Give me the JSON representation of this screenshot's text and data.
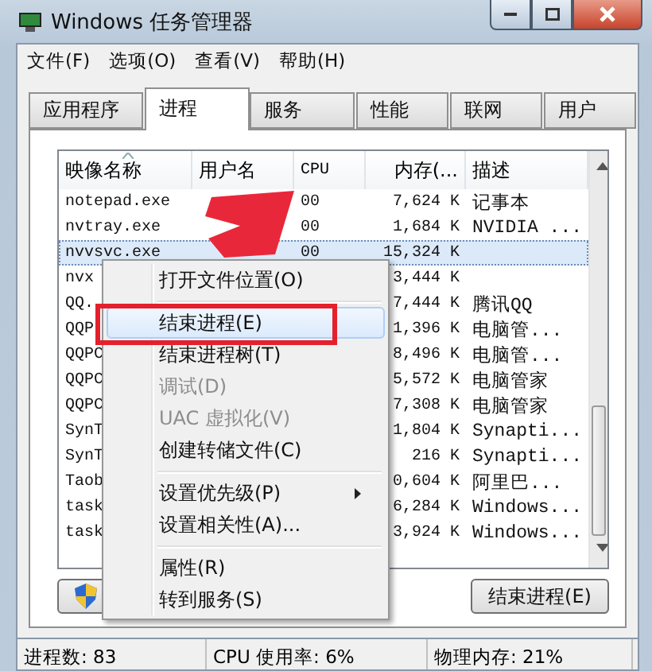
{
  "window": {
    "title": "Windows 任务管理器"
  },
  "menu_bar": [
    "文件(F)",
    "选项(O)",
    "查看(V)",
    "帮助(H)"
  ],
  "tabs": [
    {
      "label": "应用程序",
      "selected": false
    },
    {
      "label": "进程",
      "selected": true
    },
    {
      "label": "服务",
      "selected": false
    },
    {
      "label": "性能",
      "selected": false
    },
    {
      "label": "联网",
      "selected": false
    },
    {
      "label": "用户",
      "selected": false
    }
  ],
  "table": {
    "columns": [
      {
        "label": "映像名称",
        "sorted": true
      },
      {
        "label": "用户名",
        "sorted": false
      },
      {
        "label": "CPU",
        "sorted": false
      },
      {
        "label": "内存(...",
        "sorted": false
      },
      {
        "label": "描述",
        "sorted": false
      }
    ],
    "redaction": {
      "kind": "scribble"
    },
    "rows": [
      {
        "name": "notepad.exe",
        "cpu": "00",
        "memory": "7,624 K",
        "description": "记事本",
        "selected": false
      },
      {
        "name": "nvtray.exe",
        "cpu": "00",
        "memory": "1,684 K",
        "description": "NVIDIA ...",
        "selected": false
      },
      {
        "name": "nvvsvc.exe",
        "cpu": "00",
        "memory": "15,324 K",
        "selected": true
      },
      {
        "name": "nvx",
        "memory": "3,444 K",
        "selected": false
      },
      {
        "name": "QQ.",
        "memory": "7,444 K",
        "description": "腾讯QQ",
        "selected": false
      },
      {
        "name": "QQP",
        "memory": "1,396 K",
        "description": "电脑管...",
        "selected": false
      },
      {
        "name": "QQPC",
        "memory": "8,496 K",
        "description": "电脑管...",
        "selected": false
      },
      {
        "name": "QQPC",
        "memory": "5,572 K",
        "description": "电脑管家",
        "selected": false
      },
      {
        "name": "QQPC",
        "memory": "7,308 K",
        "description": "电脑管家",
        "selected": false
      },
      {
        "name": "SynT",
        "memory": "1,804 K",
        "description": "Synapti...",
        "selected": false
      },
      {
        "name": "SynT",
        "memory": "216 K",
        "description": "Synapti...",
        "selected": false
      },
      {
        "name": "Taob",
        "memory": "0,604 K",
        "description": "阿里巴...",
        "selected": false
      },
      {
        "name": "task",
        "memory": "6,284 K",
        "description": "Windows...",
        "selected": false
      },
      {
        "name": "task",
        "memory": "3,924 K",
        "description": "Windows...",
        "selected": false
      }
    ]
  },
  "buttons": [
    {
      "kind": "shield"
    },
    {
      "kind": "text",
      "label": "结束进程(E)"
    }
  ],
  "context_menu": {
    "items": [
      {
        "kind": "item",
        "label": "打开文件位置(O)",
        "disabled": false,
        "highlighted": false,
        "submenu": false,
        "boxed": false
      },
      {
        "kind": "separator"
      },
      {
        "kind": "item",
        "label": "结束进程(E)",
        "disabled": false,
        "highlighted": true,
        "submenu": false,
        "boxed": true
      },
      {
        "kind": "item",
        "label": "结束进程树(T)",
        "disabled": false,
        "highlighted": false,
        "submenu": false,
        "boxed": false
      },
      {
        "kind": "item",
        "label": "调试(D)",
        "disabled": true,
        "highlighted": false,
        "submenu": false,
        "boxed": false
      },
      {
        "kind": "item",
        "label": "UAC 虚拟化(V)",
        "disabled": true,
        "highlighted": false,
        "submenu": false,
        "boxed": false
      },
      {
        "kind": "item",
        "label": "创建转储文件(C)",
        "disabled": false,
        "highlighted": false,
        "submenu": false,
        "boxed": false
      },
      {
        "kind": "separator"
      },
      {
        "kind": "item",
        "label": "设置优先级(P)",
        "disabled": false,
        "highlighted": false,
        "submenu": true,
        "boxed": false
      },
      {
        "kind": "item",
        "label": "设置相关性(A)...",
        "disabled": false,
        "highlighted": false,
        "submenu": false,
        "boxed": false
      },
      {
        "kind": "separator"
      },
      {
        "kind": "item",
        "label": "属性(R)",
        "disabled": false,
        "highlighted": false,
        "submenu": false,
        "boxed": false
      },
      {
        "kind": "item",
        "label": "转到服务(S)",
        "disabled": false,
        "highlighted": false,
        "submenu": false,
        "boxed": false
      }
    ]
  },
  "status_bar": [
    "进程数: 83",
    "CPU 使用率: 6%",
    "物理内存: 21%"
  ]
}
